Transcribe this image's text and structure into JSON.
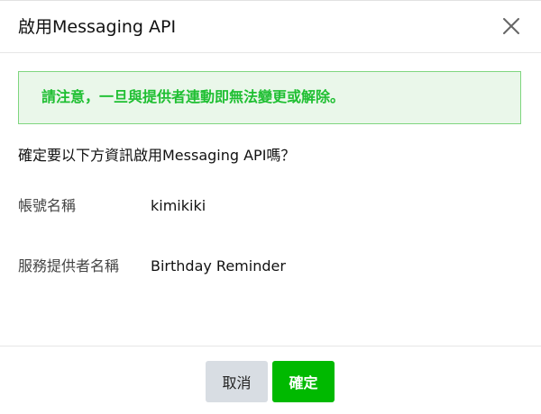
{
  "dialog": {
    "title": "啟用Messaging API",
    "close_icon": "close-icon",
    "notice": "請注意，一旦與提供者連動即無法變更或解除。",
    "question": "確定要以下方資訊啟用Messaging API嗎？",
    "fields": [
      {
        "label": "帳號名稱",
        "value": "kimikiki"
      },
      {
        "label": "服務提供者名稱",
        "value": "Birthday Reminder"
      }
    ],
    "buttons": {
      "cancel_label": "取消",
      "confirm_label": "確定"
    }
  },
  "colors": {
    "accent": "#00b900",
    "notice_text": "#1fbf32",
    "notice_bg": "#eaf7ea",
    "notice_border": "#7fd67f",
    "cancel_bg": "#d8dde3"
  }
}
